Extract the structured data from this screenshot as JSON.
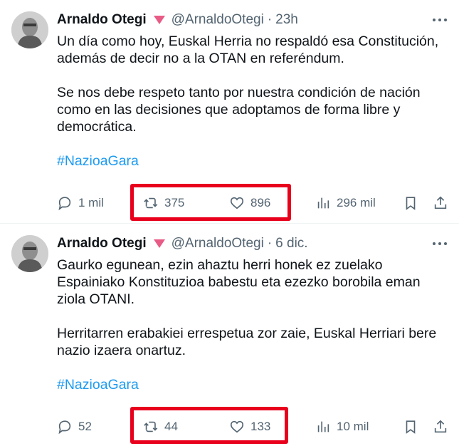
{
  "tweets": [
    {
      "author": "Arnaldo Otegi",
      "handle": "@ArnaldoOtegi",
      "separator": "·",
      "time": "23h",
      "paragraph1": "Un día como hoy, Euskal Herria no respaldó esa Constitución, además de decir no a la OTAN en referéndum.",
      "paragraph2": "Se nos debe respeto tanto por nuestra condición de nación como en las decisiones que adoptamos de forma libre y democrática.",
      "hashtag": "#NazioaGara",
      "replies": "1 mil",
      "retweets": "375",
      "likes": "896",
      "views": "296 mil"
    },
    {
      "author": "Arnaldo Otegi",
      "handle": "@ArnaldoOtegi",
      "separator": "·",
      "time": "6 dic.",
      "paragraph1": "Gaurko egunean, ezin ahaztu herri honek ez zuelako Espainiako Konstituzioa babestu eta ezezko borobila eman ziola OTANI.",
      "paragraph2": "Herritarren erabakiei errespetua zor zaie, Euskal Herriari bere nazio izaera onartuz.",
      "hashtag": "#NazioaGara",
      "replies": "52",
      "retweets": "44",
      "likes": "133",
      "views": "10 mil"
    }
  ],
  "colors": {
    "highlight": "#e8001c",
    "hashtag": "#1d9bf0",
    "muted": "#536471",
    "heart_badge": "#e0245e"
  },
  "icons": [
    "avatar",
    "heart-badge-icon",
    "more-icon",
    "reply-icon",
    "retweet-icon",
    "like-icon",
    "views-icon",
    "bookmark-icon",
    "share-icon"
  ]
}
